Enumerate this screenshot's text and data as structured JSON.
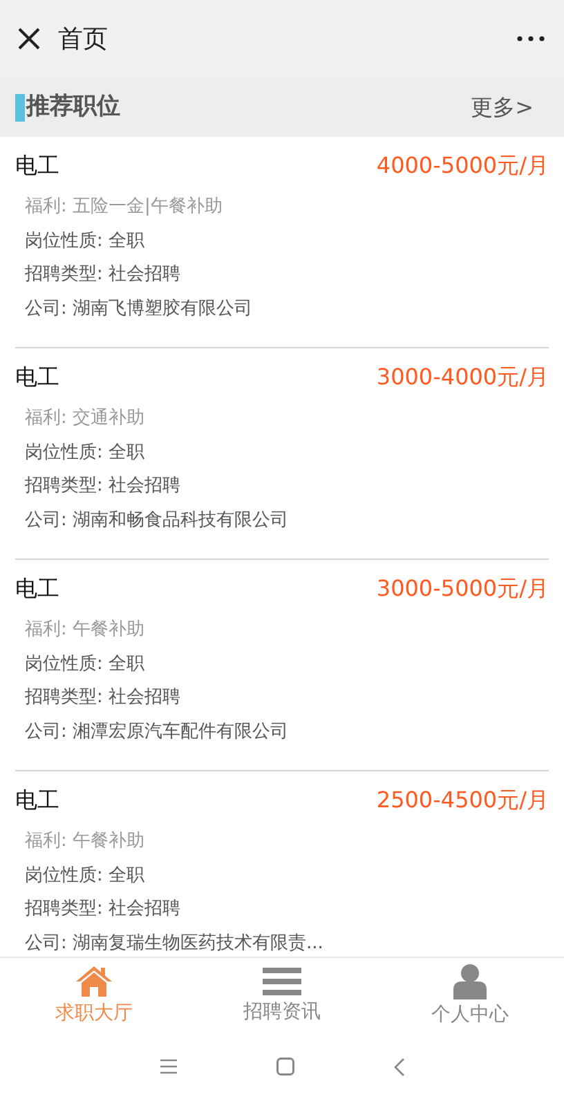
{
  "header": {
    "title": "首页"
  },
  "section": {
    "title": "推荐职位",
    "more": "更多>"
  },
  "jobs": [
    {
      "title": "电工",
      "salary": "4000-5000元/月",
      "benefits": "福利: 五险一金|午餐补助",
      "nature": "岗位性质: 全职",
      "type": "招聘类型: 社会招聘",
      "company": "公司: 湖南飞博塑胶有限公司"
    },
    {
      "title": "电工",
      "salary": "3000-4000元/月",
      "benefits": "福利: 交通补助",
      "nature": "岗位性质: 全职",
      "type": "招聘类型: 社会招聘",
      "company": "公司: 湖南和畅食品科技有限公司"
    },
    {
      "title": "电工",
      "salary": "3000-5000元/月",
      "benefits": "福利: 午餐补助",
      "nature": "岗位性质: 全职",
      "type": "招聘类型: 社会招聘",
      "company": "公司: 湘潭宏原汽车配件有限公司"
    },
    {
      "title": "电工",
      "salary": "2500-4500元/月",
      "benefits": "福利: 午餐补助",
      "nature": "岗位性质: 全职",
      "type": "招聘类型: 社会招聘",
      "company": "公司: 湖南复瑞生物医药技术有限责..."
    }
  ],
  "tabs": [
    {
      "kind": "home",
      "label": "求职大厅",
      "selected": true
    },
    {
      "kind": "list",
      "label": "招聘资讯",
      "selected": false
    },
    {
      "kind": "person",
      "label": "个人中心",
      "selected": false
    }
  ]
}
